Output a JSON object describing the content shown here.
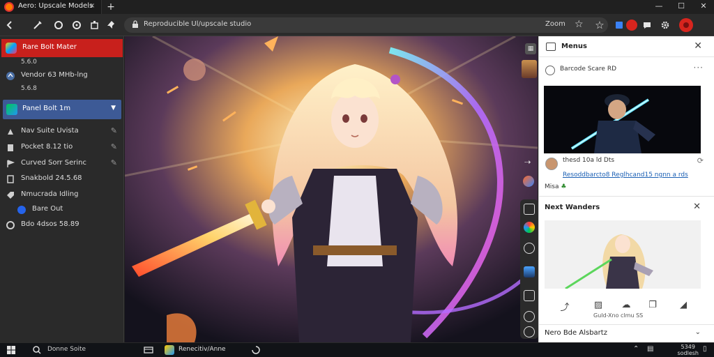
{
  "tab": {
    "title": "Aero: Upscale Models",
    "close": "×",
    "new": "+"
  },
  "window": {
    "minimize": "—",
    "maximize": "☐",
    "close": "✕"
  },
  "toolbar": {
    "url": "Reproducible Ul/upscale studio",
    "zoom": "Zoom"
  },
  "sidebar": {
    "top_title": "Rare Bolt Mater",
    "top_sub": "5.6.0",
    "second_title": "Vendor 63 MHb-lng",
    "second_sub": "5.6.8",
    "selected": "Panel Bolt 1m",
    "items": [
      {
        "label": "Nav Suite Uvista"
      },
      {
        "label": "Pocket 8.12 tio"
      },
      {
        "label": "Curved Sorr Serinc"
      },
      {
        "label": "Snakbold 24.5.68"
      },
      {
        "label": "Nmucrada Idling"
      },
      {
        "label": "Bare Out"
      },
      {
        "label": "Bdo 4dsos 58.89"
      }
    ]
  },
  "panel": {
    "title": "Menus",
    "card1": {
      "header": "Barcode Scare RD",
      "author": "thesd 10a ld Dts",
      "link": "Resoddbarcto8 Reglhcand15 ngnn a rds",
      "meta": "Misa"
    },
    "card2": {
      "title": "Next Wanders",
      "action_label": "Guld-Xno clmu SS"
    },
    "card3": {
      "title": "Nero Bde Alsbartz"
    }
  },
  "taskbar": {
    "search": "Donne Soite",
    "app": "Renecitiv/Anne",
    "time": "5349",
    "date": "sodlesh"
  },
  "colors": {
    "accent_red": "#c8201c",
    "selected_blue": "#3d5a96",
    "panel_bg": "#ffffff",
    "chrome_dark": "#2b2b2b"
  }
}
